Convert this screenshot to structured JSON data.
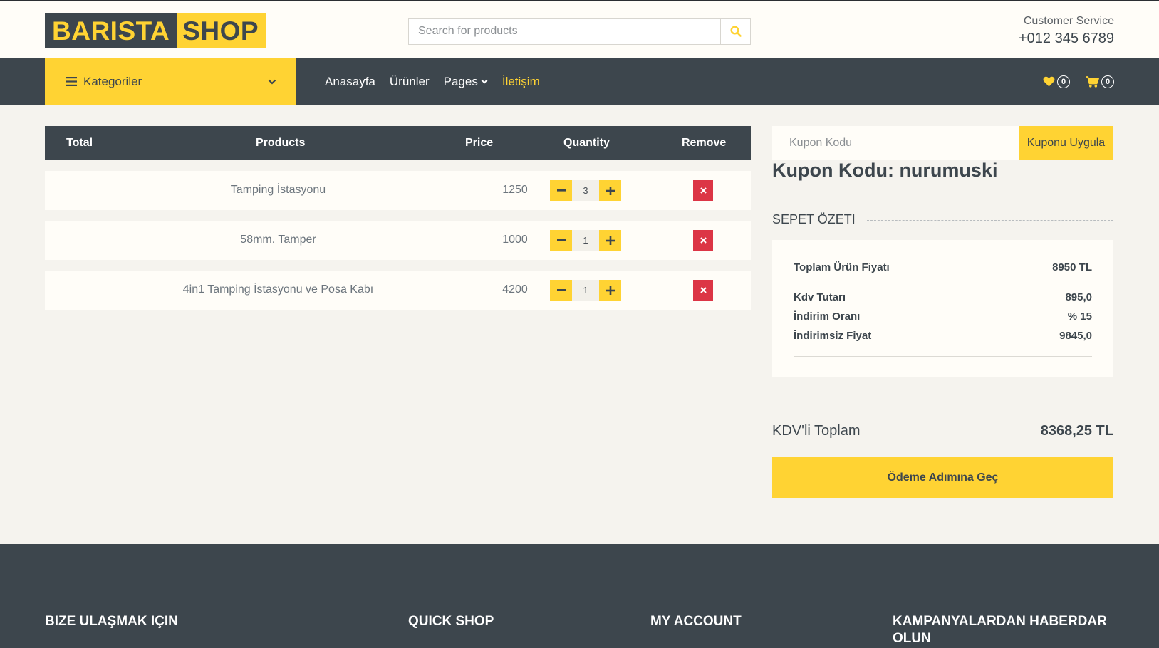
{
  "header": {
    "logo_part1": "BARISTA",
    "logo_part2": "SHOP",
    "search_placeholder": "Search for products",
    "customer_service_label": "Customer Service",
    "phone": "+012 345 6789"
  },
  "nav": {
    "categories_label": "Kategoriler",
    "links": [
      "Anasayfa",
      "Ürünler",
      "Pages",
      "İletişim"
    ],
    "wishlist_count": "0",
    "cart_count": "0"
  },
  "table": {
    "headers": [
      "Total",
      "Products",
      "Price",
      "Quantity",
      "Remove"
    ],
    "rows": [
      {
        "product": "Tamping İstasyonu",
        "price": "1250",
        "qty": "3"
      },
      {
        "product": "58mm. Tamper",
        "price": "1000",
        "qty": "1"
      },
      {
        "product": "4in1 Tamping İstasyonu ve Posa Kabı",
        "price": "4200",
        "qty": "1"
      }
    ]
  },
  "coupon": {
    "placeholder": "Kupon Kodu",
    "apply_label": "Kuponu Uygula",
    "title": "Kupon Kodu: nurumuski"
  },
  "summary": {
    "heading": "SEPET ÖZETI",
    "items": [
      {
        "label": "Toplam Ürün Fiyatı",
        "value": "8950 TL"
      },
      {
        "label": "Kdv Tutarı",
        "value": "895,0"
      },
      {
        "label": "İndirim Oranı",
        "value": "% 15"
      },
      {
        "label": "İndirimsiz Fiyat",
        "value": "9845,0"
      }
    ],
    "total_label": "KDV'li Toplam",
    "total_value": "8368,25 TL",
    "checkout_label": "Ödeme Adımına Geç"
  },
  "footer": {
    "headings": [
      "BIZE ULAŞMAK IÇIN",
      "QUICK SHOP",
      "MY ACCOUNT",
      "KAMPANYALARDAN HABERDAR OLUN"
    ]
  },
  "colors": {
    "accent": "#ffd333",
    "dark": "#3d464d",
    "danger": "#dc3545"
  }
}
